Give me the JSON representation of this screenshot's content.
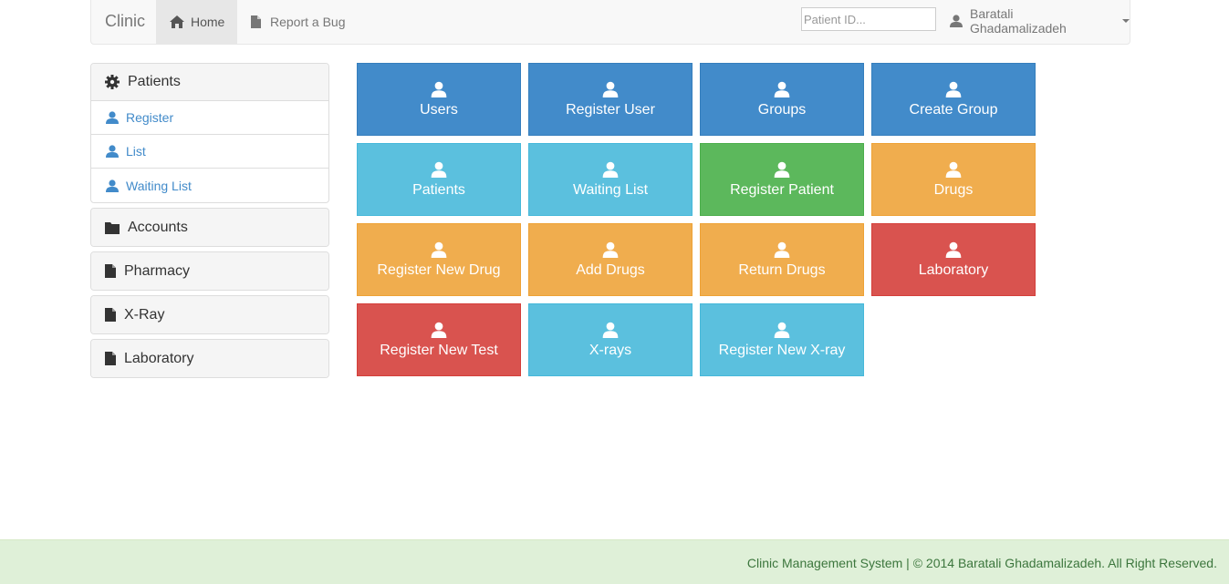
{
  "navbar": {
    "brand": "Clinic",
    "home_label": "Home",
    "bug_label": "Report a Bug",
    "search_placeholder": "Patient ID...",
    "user_name": "Baratali Ghadamalizadeh"
  },
  "sidebar": {
    "patients": {
      "title": "Patients",
      "items": [
        {
          "label": "Register"
        },
        {
          "label": "List"
        },
        {
          "label": "Waiting List"
        }
      ]
    },
    "accounts": "Accounts",
    "pharmacy": "Pharmacy",
    "xray": "X-Ray",
    "laboratory": "Laboratory"
  },
  "tiles": [
    {
      "label": "Users",
      "color": "#428bca"
    },
    {
      "label": "Register User",
      "color": "#428bca"
    },
    {
      "label": "Groups",
      "color": "#428bca"
    },
    {
      "label": "Create Group",
      "color": "#428bca"
    },
    {
      "label": "Patients",
      "color": "#5bc0de"
    },
    {
      "label": "Waiting List",
      "color": "#5bc0de"
    },
    {
      "label": "Register Patient",
      "color": "#5cb85c"
    },
    {
      "label": "Drugs",
      "color": "#f0ad4e"
    },
    {
      "label": "Register New Drug",
      "color": "#f0ad4e"
    },
    {
      "label": "Add Drugs",
      "color": "#f0ad4e"
    },
    {
      "label": "Return Drugs",
      "color": "#f0ad4e"
    },
    {
      "label": "Laboratory",
      "color": "#d9534f"
    },
    {
      "label": "Register New Test",
      "color": "#d9534f"
    },
    {
      "label": "X-rays",
      "color": "#5bc0de"
    },
    {
      "label": "Register New X-ray",
      "color": "#5bc0de"
    }
  ],
  "footer": {
    "text": "Clinic Management System | © 2014 Baratali Ghadamalizadeh. All Right Reserved."
  }
}
